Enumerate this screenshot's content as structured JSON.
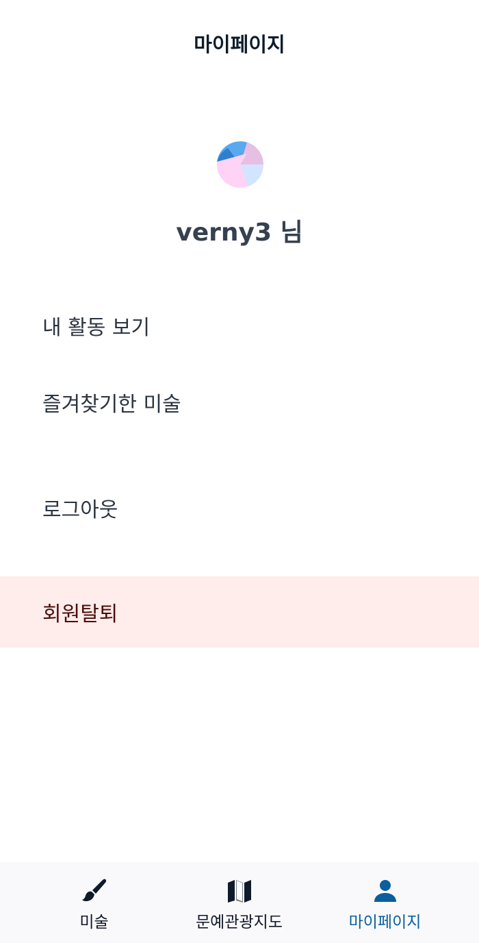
{
  "header": {
    "title": "마이페이지"
  },
  "profile": {
    "username": "verny3 님"
  },
  "menu": {
    "activity": "내 활동 보기",
    "favorites": "즐겨찾기한 미술",
    "logout": "로그아웃",
    "withdraw": "회원탈퇴"
  },
  "tabbar": {
    "tabs": [
      {
        "label": "미술",
        "icon": "brush-icon"
      },
      {
        "label": "문예관광지도",
        "icon": "map-icon"
      },
      {
        "label": "마이페이지",
        "icon": "user-icon",
        "active": true
      }
    ]
  },
  "colors": {
    "active_tab": "#0a5f9e",
    "danger_bg": "#feedea"
  }
}
